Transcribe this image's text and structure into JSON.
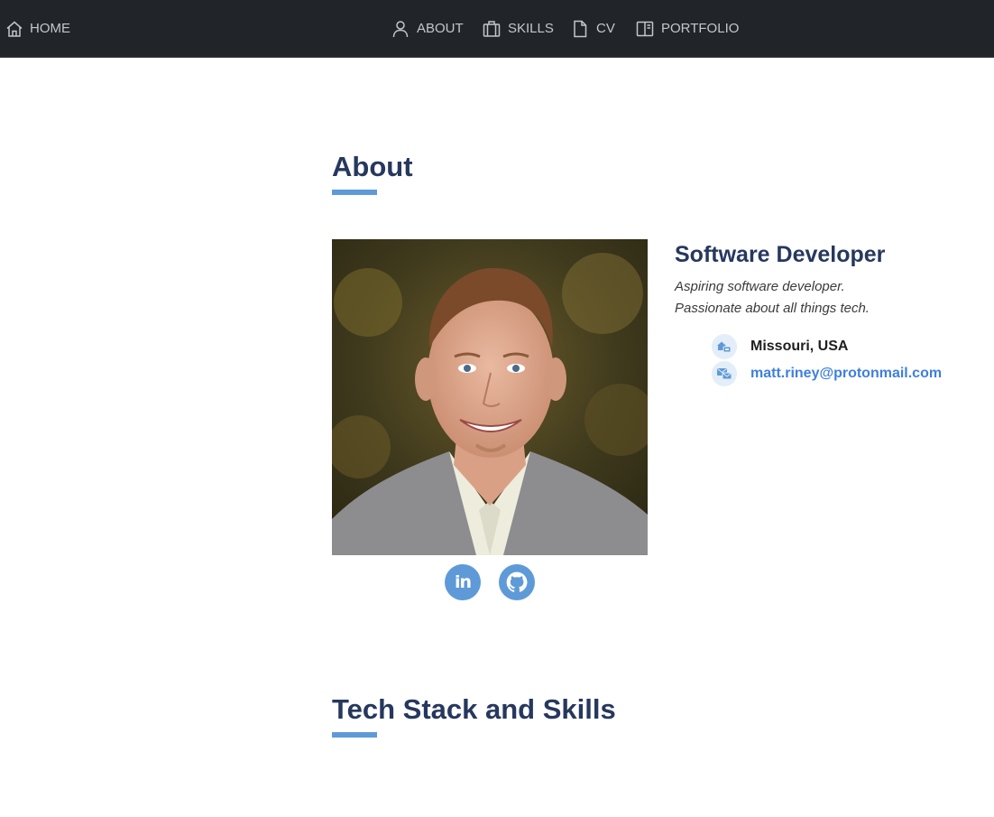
{
  "nav": {
    "home": {
      "label": "HOME",
      "icon": "home-icon"
    },
    "about": {
      "label": "ABOUT",
      "icon": "person-icon"
    },
    "skills": {
      "label": "SKILLS",
      "icon": "briefcase-icon"
    },
    "cv": {
      "label": "CV",
      "icon": "document-icon"
    },
    "portfolio": {
      "label": "PORTFOLIO",
      "icon": "book-icon"
    }
  },
  "about": {
    "title": "About",
    "photo_alt": "Profile photo",
    "role": "Software Developer",
    "tagline_line1": "Aspiring software developer.",
    "tagline_line2": "Passionate about all things tech.",
    "location": "Missouri, USA",
    "email": "matt.riney@protonmail.com",
    "social": [
      {
        "name": "linkedin",
        "icon": "linkedin-icon",
        "glyph": "in"
      },
      {
        "name": "github",
        "icon": "github-icon"
      }
    ]
  },
  "skills": {
    "title": "Tech Stack and Skills"
  },
  "colors": {
    "navbar": "#212529",
    "nav_text": "#c3c7cb",
    "heading": "#26385e",
    "accent": "#5f9ad8",
    "link": "#3f7fdc",
    "icon_bg": "#e3eef9"
  }
}
